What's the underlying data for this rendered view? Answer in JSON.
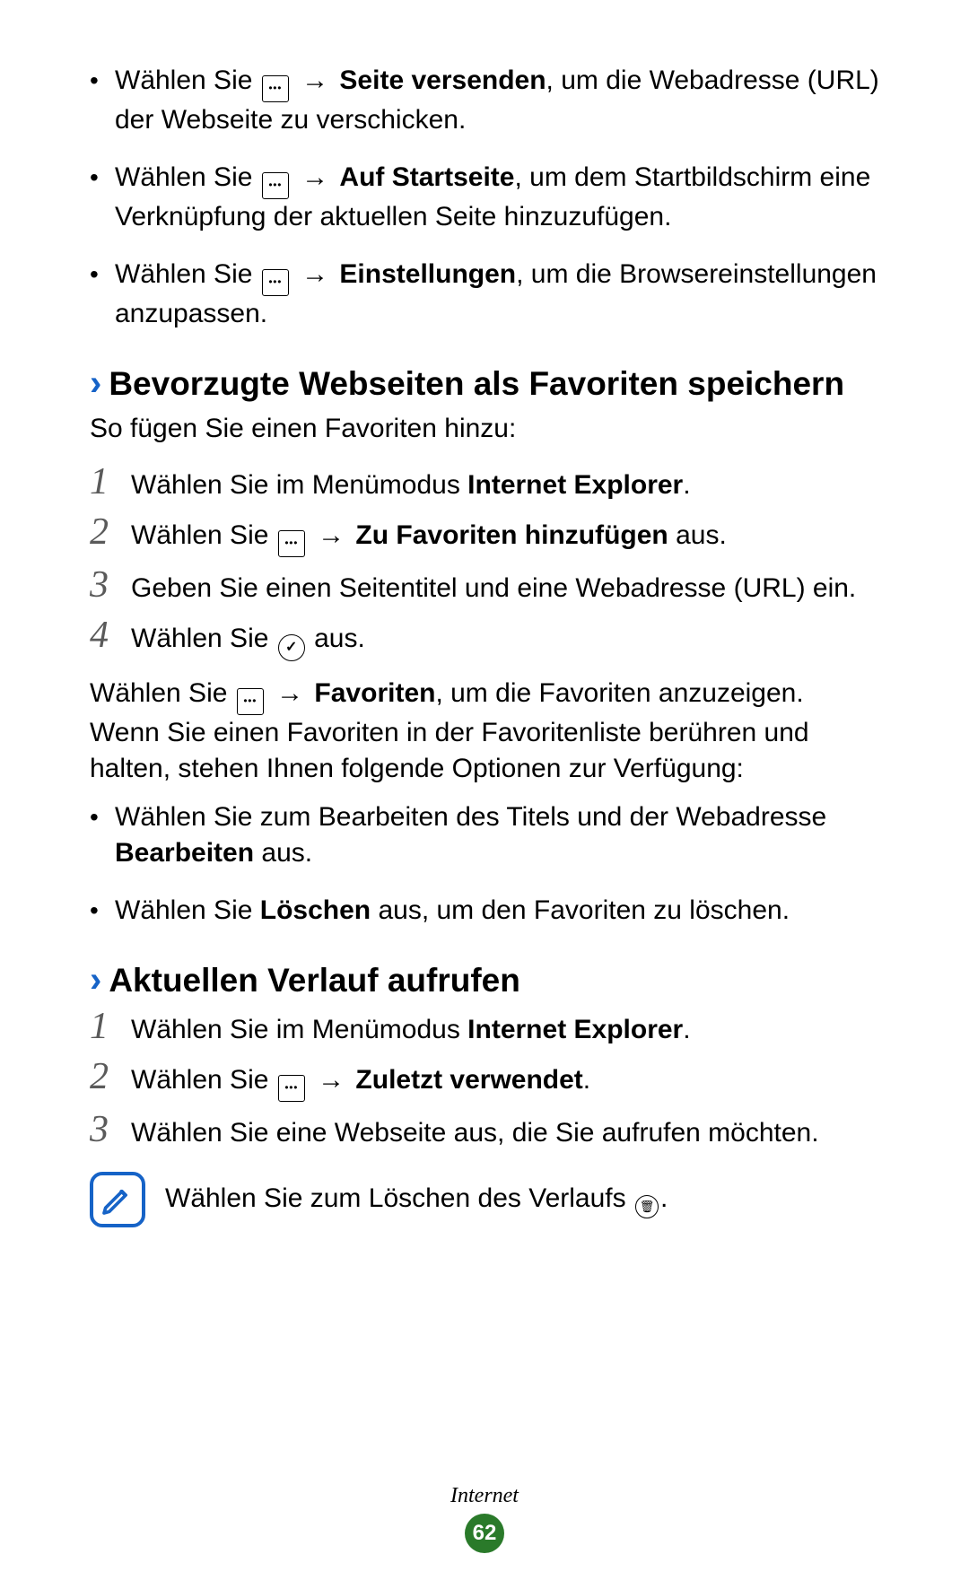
{
  "topBullets": [
    {
      "pre": "Wählen Sie ",
      "bold": "Seite versenden",
      "post": ", um die Webadresse (URL) der Webseite zu verschicken."
    },
    {
      "pre": "Wählen Sie ",
      "bold": "Auf Startseite",
      "post": ", um dem Startbildschirm eine Verknüpfung der aktuellen Seite hinzuzufügen."
    },
    {
      "pre": "Wählen Sie ",
      "bold": "Einstellungen",
      "post": ", um die Browsereinstellungen anzupassen."
    }
  ],
  "section1": {
    "title": "Bevorzugte Webseiten als Favoriten speichern",
    "intro": "So fügen Sie einen Favoriten hinzu:",
    "steps": [
      {
        "n": "1",
        "pre": "Wählen Sie im Menümodus ",
        "bold": "Internet Explorer",
        "post": "."
      },
      {
        "n": "2",
        "pre": "Wählen Sie ",
        "useMenuIcon": true,
        "bold": "Zu Favoriten hinzufügen",
        "post": " aus."
      },
      {
        "n": "3",
        "pre": "Geben Sie einen Seitentitel und eine Webadresse (URL) ein.",
        "bold": "",
        "post": ""
      },
      {
        "n": "4",
        "pre": "Wählen Sie ",
        "useCheckIcon": true,
        "bold": "",
        "post": " aus."
      }
    ],
    "paraPre": "Wählen Sie ",
    "paraBold": "Favoriten",
    "paraPost": ", um die Favoriten anzuzeigen. Wenn Sie einen Favoriten in der Favoritenliste berühren und halten, stehen Ihnen folgende Optionen zur Verfügung:",
    "subBullets": [
      {
        "pre": "Wählen Sie zum Bearbeiten des Titels und der Webadresse ",
        "bold": "Bearbeiten",
        "post": " aus."
      },
      {
        "pre": "Wählen Sie ",
        "bold": "Löschen",
        "post": " aus, um den Favoriten zu löschen."
      }
    ]
  },
  "section2": {
    "title": "Aktuellen Verlauf aufrufen",
    "steps": [
      {
        "n": "1",
        "pre": "Wählen Sie im Menümodus ",
        "bold": "Internet Explorer",
        "post": "."
      },
      {
        "n": "2",
        "pre": "Wählen Sie ",
        "useMenuIcon": true,
        "bold": "Zuletzt verwendet",
        "post": "."
      },
      {
        "n": "3",
        "pre": "Wählen Sie eine Webseite aus, die Sie aufrufen möchten.",
        "bold": "",
        "post": ""
      }
    ],
    "note": "Wählen Sie zum Löschen des Verlaufs "
  },
  "footer": {
    "label": "Internet",
    "page": "62"
  }
}
